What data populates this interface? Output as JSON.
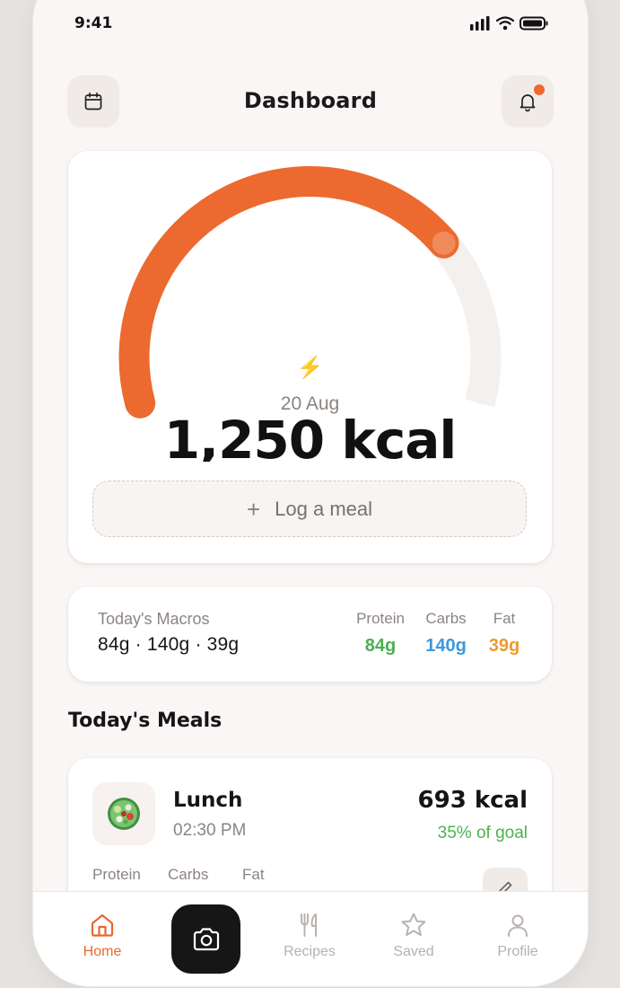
{
  "status_bar": {
    "time": "9:41"
  },
  "header": {
    "title": "Dashboard"
  },
  "gauge": {
    "date": "20 Aug",
    "calories": "1,250 kcal",
    "progress_fraction": 0.5,
    "accent_color": "#ec6a2f",
    "track_color": "#f4f0ee"
  },
  "log_meal": {
    "plus": "+",
    "label": "Log a meal"
  },
  "macros": {
    "title": "Today's Macros",
    "summary": "84g · 140g · 39g",
    "items": [
      {
        "label": "Protein",
        "value": "84g",
        "color": "#4bb050"
      },
      {
        "label": "Carbs",
        "value": "140g",
        "color": "#3b99dd"
      },
      {
        "label": "Fat",
        "value": "39g",
        "color": "#ee9b2e"
      }
    ]
  },
  "meals_section": {
    "title": "Today's Meals"
  },
  "meals": [
    {
      "name": "Lunch",
      "time": "02:30 PM",
      "calories": "693 kcal",
      "goal": "35% of goal",
      "macros": [
        "Protein",
        "Carbs",
        "Fat"
      ],
      "icon": "salad-bowl-icon"
    }
  ],
  "tab_bar": {
    "items": [
      {
        "label": "Home",
        "icon": "home-icon",
        "active": true
      },
      {
        "label": "",
        "icon": "camera-icon",
        "active": false
      },
      {
        "label": "Recipes",
        "icon": "fork-knife-icon",
        "active": false
      },
      {
        "label": "Saved",
        "icon": "star-icon",
        "active": false
      },
      {
        "label": "Profile",
        "icon": "profile-icon",
        "active": false
      }
    ]
  }
}
